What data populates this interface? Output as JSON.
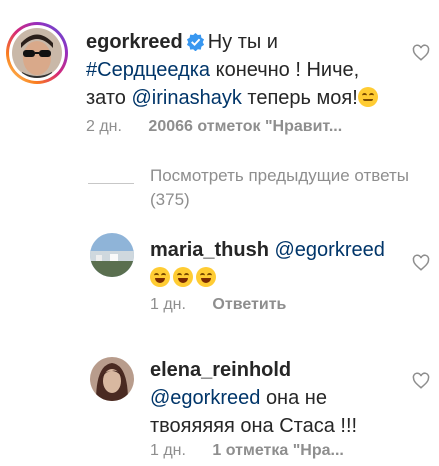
{
  "comments": [
    {
      "username": "egorkreed",
      "text_1": "Ну ты и",
      "hashtag": "#Сердцеедка",
      "text_2": "конечно ! Ниче,",
      "text_3": "зато",
      "mention": "@irinashayk",
      "text_4": "теперь моя!",
      "time": "2 дн.",
      "likes": "20066 отметок \"Нравит..."
    },
    {
      "username": "maria_thush",
      "mention": "@egorkreed",
      "time": "1 дн.",
      "reply": "Ответить"
    },
    {
      "username": "elena_reinhold",
      "mention": "@egorkreed",
      "text_1": "она не",
      "text_2": "твояяяяя она Стаса !!!",
      "time": "1 дн.",
      "likes": "1 отметка \"Нра..."
    }
  ],
  "view_previous": {
    "line_1": "Посмотреть предыдущие ответы",
    "line_2": "(375)"
  },
  "icons": {
    "verified": "verified-badge-icon",
    "like": "heart-icon",
    "emoji_grin": "grinning-face-emoji",
    "emoji_relieved": "relieved-face-emoji"
  },
  "colors": {
    "link": "#003569",
    "meta": "#8e8e8e",
    "verified": "#3897f0"
  }
}
